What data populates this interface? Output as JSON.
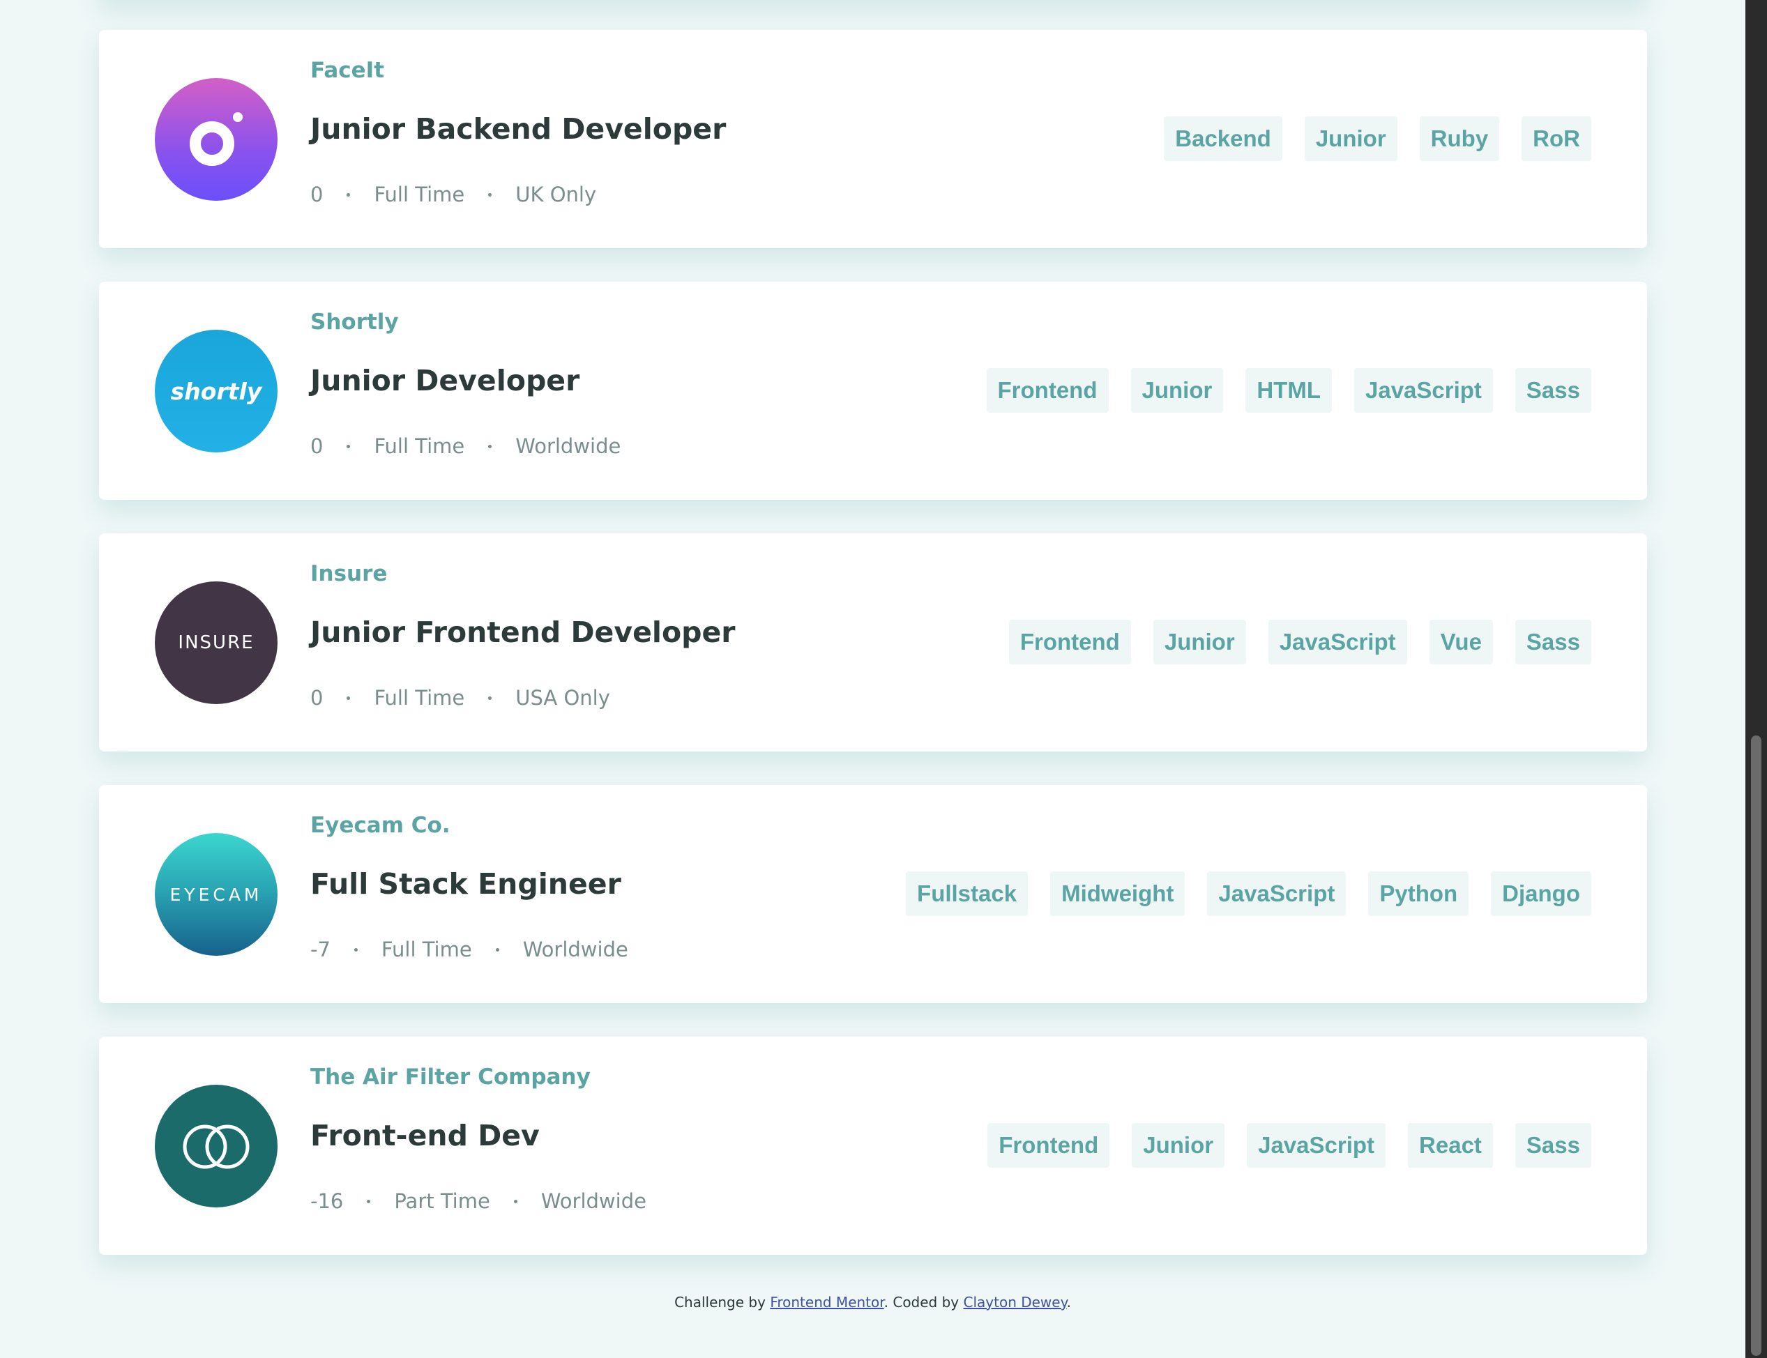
{
  "jobs": [
    {
      "company": "FaceIt",
      "position": "Junior Backend Developer",
      "posted": "0",
      "contract": "Full Time",
      "location": "UK Only",
      "logo_icon": "faceit-logo-icon",
      "logo_text": "",
      "tags": [
        "Backend",
        "Junior",
        "Ruby",
        "RoR"
      ]
    },
    {
      "company": "Shortly",
      "position": "Junior Developer",
      "posted": "0",
      "contract": "Full Time",
      "location": "Worldwide",
      "logo_icon": "shortly-logo-icon",
      "logo_text": "shortly",
      "tags": [
        "Frontend",
        "Junior",
        "HTML",
        "JavaScript",
        "Sass"
      ]
    },
    {
      "company": "Insure",
      "position": "Junior Frontend Developer",
      "posted": "0",
      "contract": "Full Time",
      "location": "USA Only",
      "logo_icon": "insure-logo-icon",
      "logo_text": "INSURE",
      "tags": [
        "Frontend",
        "Junior",
        "JavaScript",
        "Vue",
        "Sass"
      ]
    },
    {
      "company": "Eyecam Co.",
      "position": "Full Stack Engineer",
      "posted": "-7",
      "contract": "Full Time",
      "location": "Worldwide",
      "logo_icon": "eyecam-logo-icon",
      "logo_text": "EYECAM",
      "tags": [
        "Fullstack",
        "Midweight",
        "JavaScript",
        "Python",
        "Django"
      ]
    },
    {
      "company": "The Air Filter Company",
      "position": "Front-end Dev",
      "posted": "-16",
      "contract": "Part Time",
      "location": "Worldwide",
      "logo_icon": "air-filter-logo-icon",
      "logo_text": "",
      "tags": [
        "Frontend",
        "Junior",
        "JavaScript",
        "React",
        "Sass"
      ]
    }
  ],
  "footer": {
    "prefix": "Challenge by ",
    "challenge_link": "Frontend Mentor",
    "middle": ". Coded by ",
    "author_link": "Clayton Dewey",
    "suffix": "."
  },
  "colors": {
    "background": "#eff7f7",
    "accent": "#5ba4a4",
    "heading": "#2c3a3a",
    "meta": "#7b8e8e",
    "tag_bg": "#eff6f6",
    "link": "#3e52a3"
  }
}
